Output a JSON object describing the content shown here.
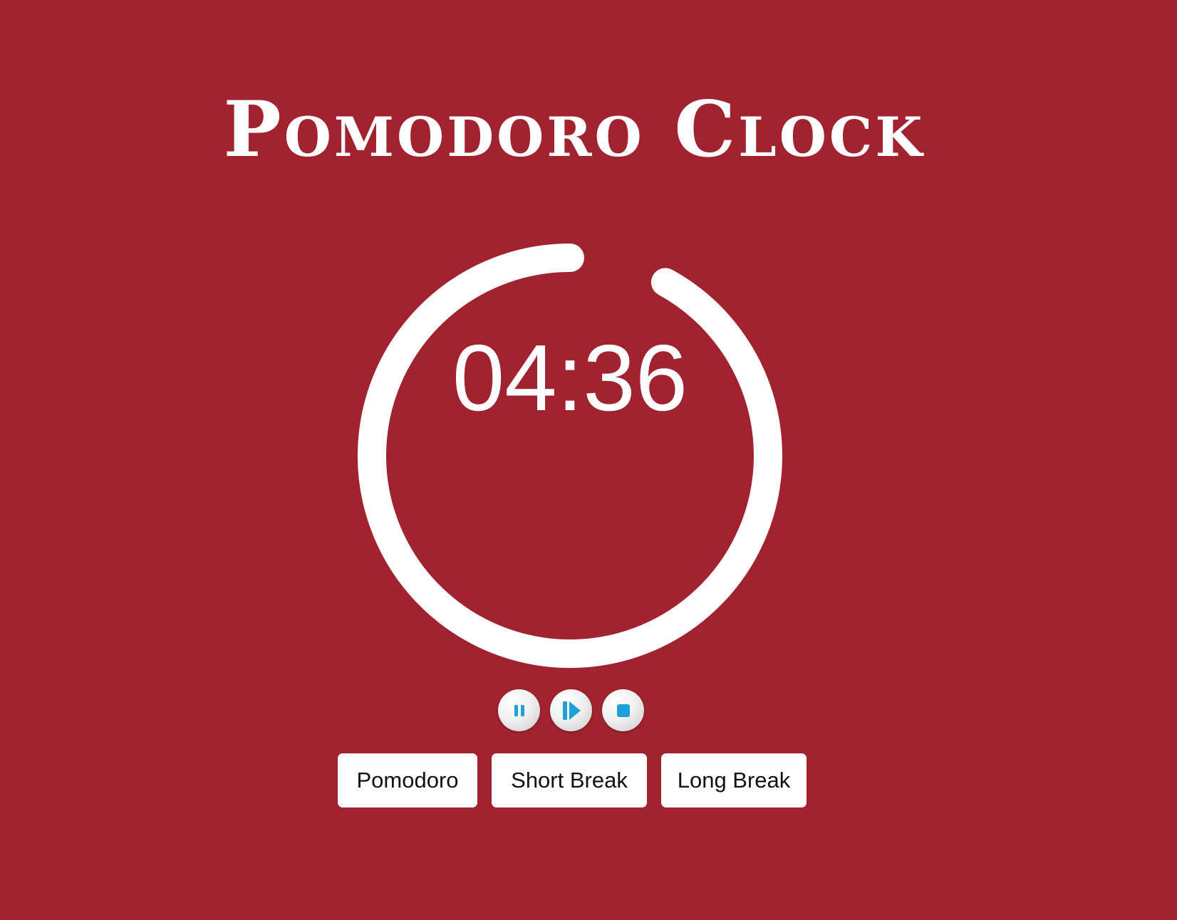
{
  "title": "Pomodoro Clock",
  "timer": {
    "display": "04:36",
    "progress_fraction": 0.92
  },
  "controls": [
    {
      "name": "pause",
      "icon": "pause-icon"
    },
    {
      "name": "play",
      "icon": "play-icon"
    },
    {
      "name": "stop",
      "icon": "stop-icon"
    }
  ],
  "modes": {
    "pomodoro": "Pomodoro",
    "short_break": "Short Break",
    "long_break": "Long Break"
  },
  "colors": {
    "background": "#a22330",
    "ring": "#ffffff",
    "icon": "#1da1d8"
  }
}
